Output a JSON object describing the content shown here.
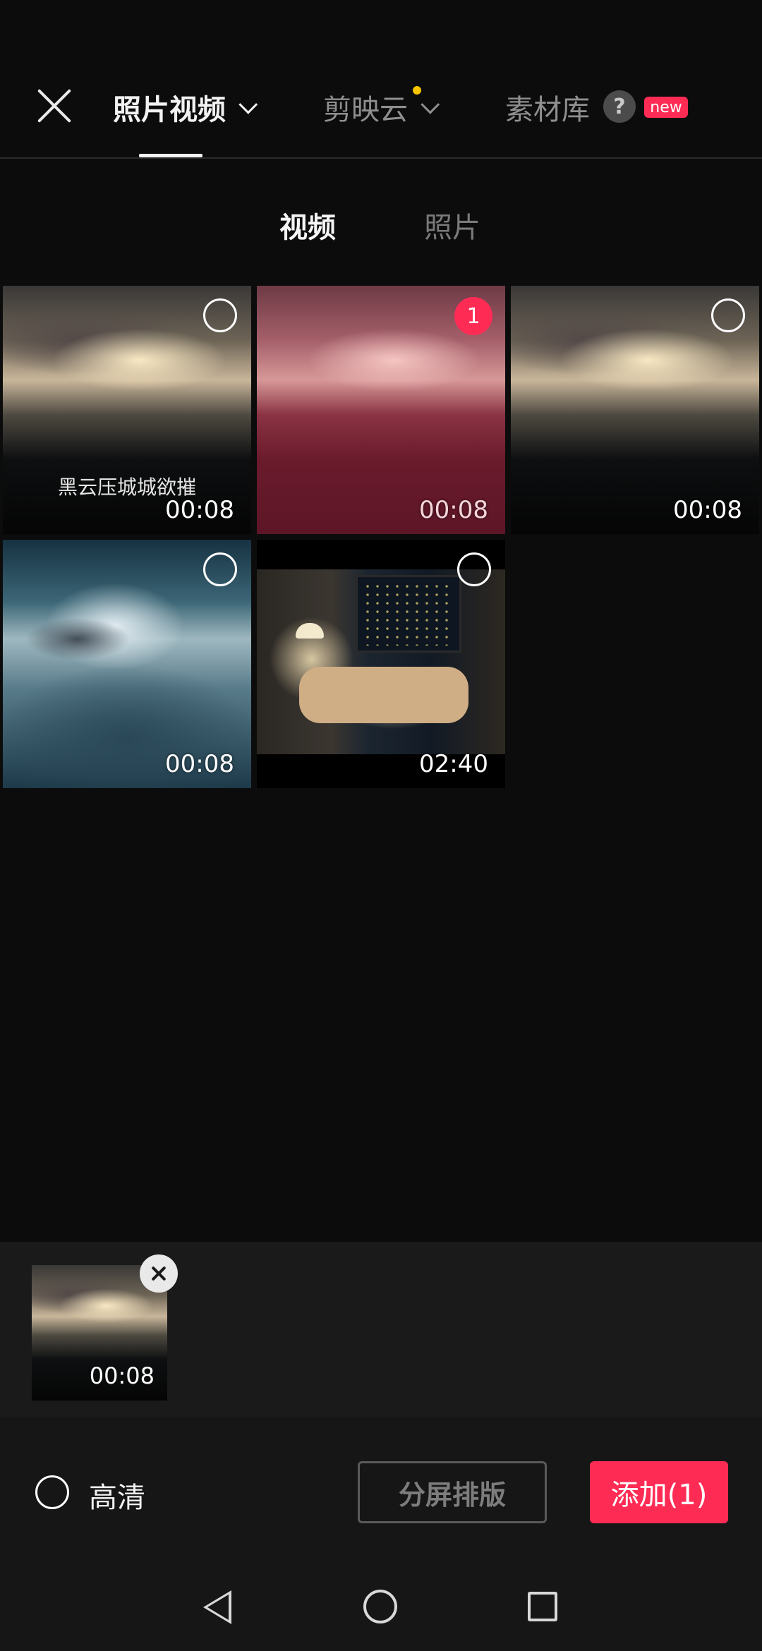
{
  "header": {
    "tabs": [
      {
        "label": "照片视频",
        "active": true,
        "has_dropdown": true
      },
      {
        "label": "剪映云",
        "active": false,
        "has_dropdown": true,
        "has_dot": true
      },
      {
        "label": "素材库",
        "active": false,
        "help_icon": "?",
        "badge": "new"
      }
    ],
    "close_icon": "close-icon"
  },
  "subtabs": [
    {
      "label": "视频",
      "active": true
    },
    {
      "label": "照片",
      "active": false
    }
  ],
  "media": [
    {
      "duration": "00:08",
      "caption": "黑云压城城欲摧",
      "selected": false,
      "thumb": "dark-sky"
    },
    {
      "duration": "00:08",
      "selected": true,
      "selection_number": "1",
      "thumb": "pink-sky"
    },
    {
      "duration": "00:08",
      "selected": false,
      "thumb": "dark-sky"
    },
    {
      "duration": "00:08",
      "selected": false,
      "thumb": "clouds"
    },
    {
      "duration": "02:40",
      "selected": false,
      "thumb": "living-room"
    }
  ],
  "tray": {
    "items": [
      {
        "duration": "00:08",
        "thumb": "dark-sky"
      }
    ]
  },
  "actions": {
    "hd_label": "高清",
    "split_label": "分屏排版",
    "add_label": "添加(1)"
  },
  "colors": {
    "accent": "#fe2c55",
    "background": "#0c0c0c",
    "badge_dot": "#f6c500"
  },
  "navbar": {
    "icons": [
      "back-icon",
      "home-icon",
      "recents-icon"
    ]
  }
}
